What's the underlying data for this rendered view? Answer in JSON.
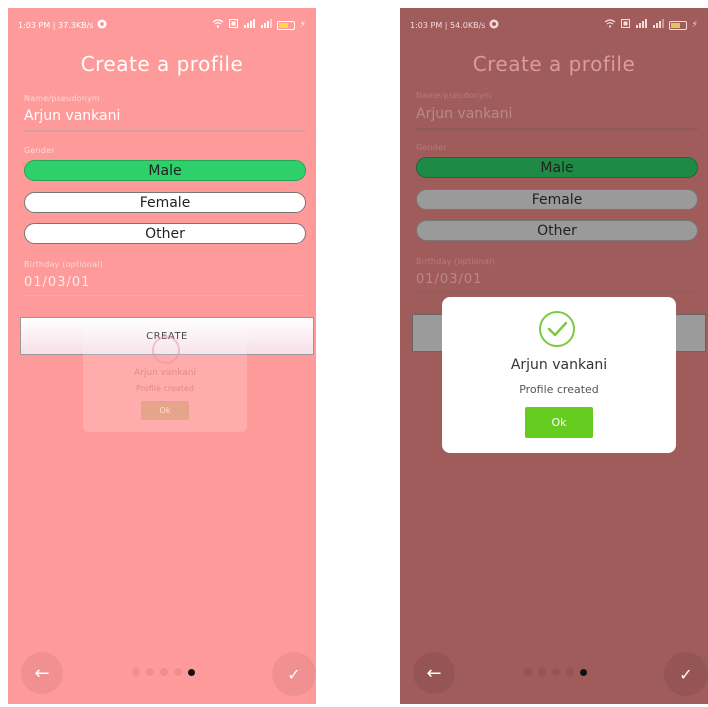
{
  "left_screen": {
    "status": {
      "time_speed": "1:03 PM | 37.3KB/s",
      "app_icon": "app-notification-icon"
    },
    "title": "Create a profile",
    "name_label": "Name/pseudonym",
    "name_value": "Arjun vankani",
    "gender_label": "Gender",
    "gender_options": [
      "Male",
      "Female",
      "Other"
    ],
    "gender_selected": "Male",
    "birthday_label": "Birthday (optional)",
    "birthday_value": "01/03/01",
    "create_label": "CREATE",
    "ghost_dialog": {
      "name": "Arjun vankani",
      "message": "Profile created",
      "ok": "Ok"
    },
    "nav": {
      "back_icon": "←",
      "done_icon": "✓",
      "dots_total": 5,
      "dots_active": 5
    }
  },
  "right_screen": {
    "status": {
      "time_speed": "1:03 PM | 54.0KB/s",
      "app_icon": "app-notification-icon"
    },
    "title": "Create a profile",
    "name_label": "Name/pseudonym",
    "name_value": "Arjun vankani",
    "gender_label": "Gender",
    "gender_options": [
      "Male",
      "Female",
      "Other"
    ],
    "gender_selected": "Male",
    "birthday_label": "Birthday (optional)",
    "birthday_value": "01/03/01",
    "dialog": {
      "name": "Arjun vankani",
      "message": "Profile created",
      "ok": "Ok"
    },
    "nav": {
      "back_icon": "←",
      "done_icon": "✓",
      "dots_total": 5,
      "dots_active": 5
    }
  },
  "colors": {
    "left_bg": "#ff9a9a",
    "right_bg": "#a05b5b",
    "selected_green": "#2ed06a",
    "ok_green": "#66cc1f",
    "check_green": "#7ac943"
  }
}
